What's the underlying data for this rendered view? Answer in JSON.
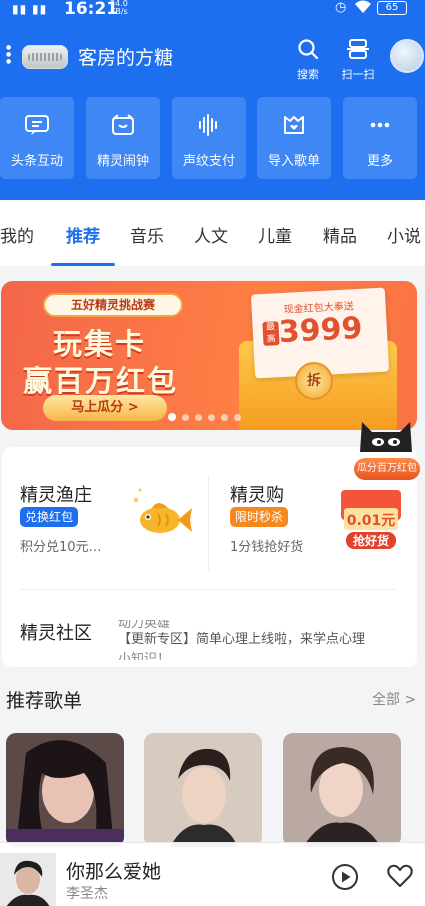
{
  "status": {
    "signal": "▮▮ ▮▮",
    "time": "16:21",
    "speed_value": "34.0",
    "speed_unit": "KB/s",
    "battery": "65"
  },
  "header": {
    "title": "客房的方糖",
    "search_label": "搜索",
    "scan_label": "扫一扫"
  },
  "shortcuts": [
    {
      "label": "头条互动",
      "icon": "message-icon"
    },
    {
      "label": "精灵闹钟",
      "icon": "alarm-icon"
    },
    {
      "label": "声纹支付",
      "icon": "voiceprint-icon"
    },
    {
      "label": "导入歌单",
      "icon": "import-icon"
    },
    {
      "label": "更多",
      "icon": "more-icon"
    }
  ],
  "tabs": [
    "我的",
    "推荐",
    "音乐",
    "人文",
    "儿童",
    "精品",
    "小说"
  ],
  "active_tab": "推荐",
  "banner": {
    "tag": "五好精灵挑战赛",
    "line1": "玩集卡",
    "line2": "赢百万红包",
    "button": "马上瓜分 >",
    "paper_title": "现金红包大奉送",
    "paper_hi": "最高",
    "amount": "3999",
    "coin": "拆"
  },
  "float_badge": "瓜分百万红包",
  "cards": {
    "fishing": {
      "title": "精灵渔庄",
      "badge": "兑换红包",
      "sub": "积分兑10元…"
    },
    "shop": {
      "title": "精灵购",
      "badge": "限时秒杀",
      "sub": "1分钱抢好货"
    },
    "gift_amount": "0.01元",
    "gift_cta": "抢好货",
    "community": {
      "title": "精灵社区",
      "line_prev": "动力英雄",
      "line_main": "【更新专区】简单心理上线啦，来学点心理",
      "line_next": "小知识！"
    }
  },
  "recommend": {
    "title": "推荐歌单",
    "all": "全部 >"
  },
  "player": {
    "song": "你那么爱她",
    "artist": "李圣杰"
  },
  "colors": {
    "brand_blue": "#1e6ff0",
    "tile_blue": "#3f87f4",
    "banner_orange": "#f3664a"
  }
}
